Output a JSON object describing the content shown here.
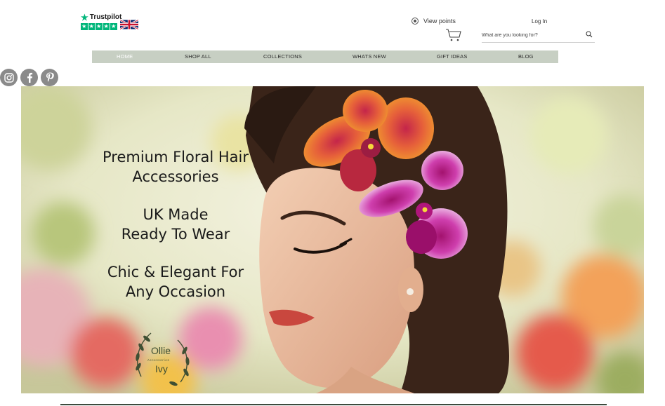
{
  "header": {
    "trustpilot_label": "Trustpilot",
    "view_points_label": "View points",
    "login_label": "Log In",
    "search_placeholder": "What are you looking for?"
  },
  "nav": {
    "items": [
      {
        "label": "HOME",
        "active": true
      },
      {
        "label": "SHOP ALL",
        "active": false
      },
      {
        "label": "COLLECTIONS",
        "active": false
      },
      {
        "label": "WHATS NEW",
        "active": false
      },
      {
        "label": "GIFT IDEAS",
        "active": false
      },
      {
        "label": "BLOG",
        "active": false
      }
    ]
  },
  "social": [
    "instagram-icon",
    "facebook-icon",
    "pinterest-icon"
  ],
  "hero": {
    "line1": "Premium Floral Hair",
    "line2": "Accessories",
    "line3": "UK Made",
    "line4": "Ready To Wear",
    "line5": "Chic & Elegant For",
    "line6": "Any Occasion",
    "logo_top": "Ollie",
    "logo_sub": "Accessories",
    "logo_bottom": "Ivy"
  },
  "colors": {
    "nav_bg": "#c7cfc3",
    "trustpilot_green": "#00b67a",
    "social_grey": "#8a8a8a"
  }
}
